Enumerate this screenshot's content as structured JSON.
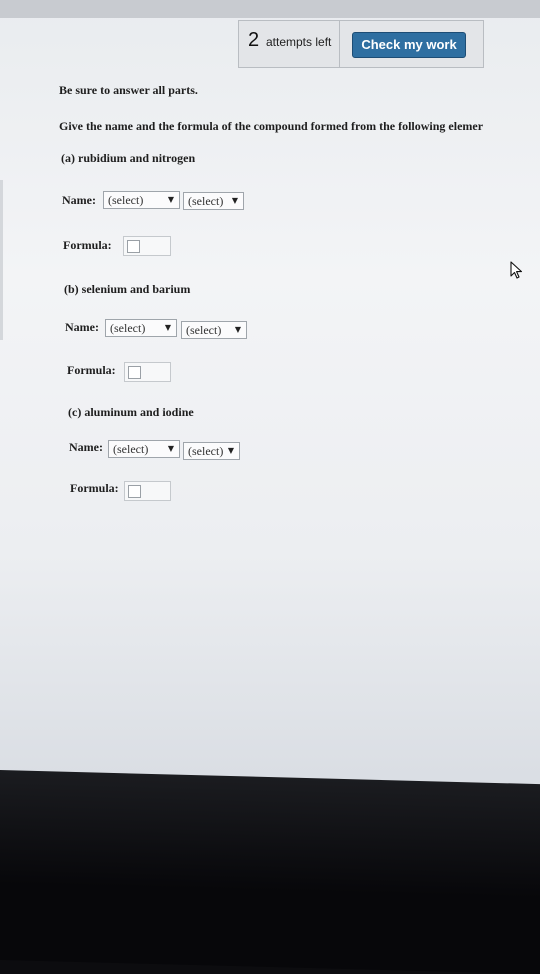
{
  "header": {
    "attempts_count": "2",
    "attempts_label": "attempts left",
    "check_button_label": "Check my work"
  },
  "instructions": "Be sure to answer all parts.",
  "question": "Give the name and the formula of the compound formed from the following elemer",
  "parts": [
    {
      "label": "(a) rubidium and nitrogen",
      "name_label": "Name:",
      "select1": "(select)",
      "select2": "(select)",
      "formula_label": "Formula:"
    },
    {
      "label": "(b) selenium and barium",
      "name_label": "Name:",
      "select1": "(select)",
      "select2": "(select)",
      "formula_label": "Formula:"
    },
    {
      "label": "(c) aluminum and iodine",
      "name_label": "Name:",
      "select1": "(select)",
      "select2": "(select)",
      "formula_label": "Formula:"
    }
  ],
  "icons": {
    "dropdown_arrow": "▼",
    "cursor": "mouse-pointer-icon"
  },
  "colors": {
    "check_button": "#2f6fa1",
    "background": "#eceef1"
  }
}
